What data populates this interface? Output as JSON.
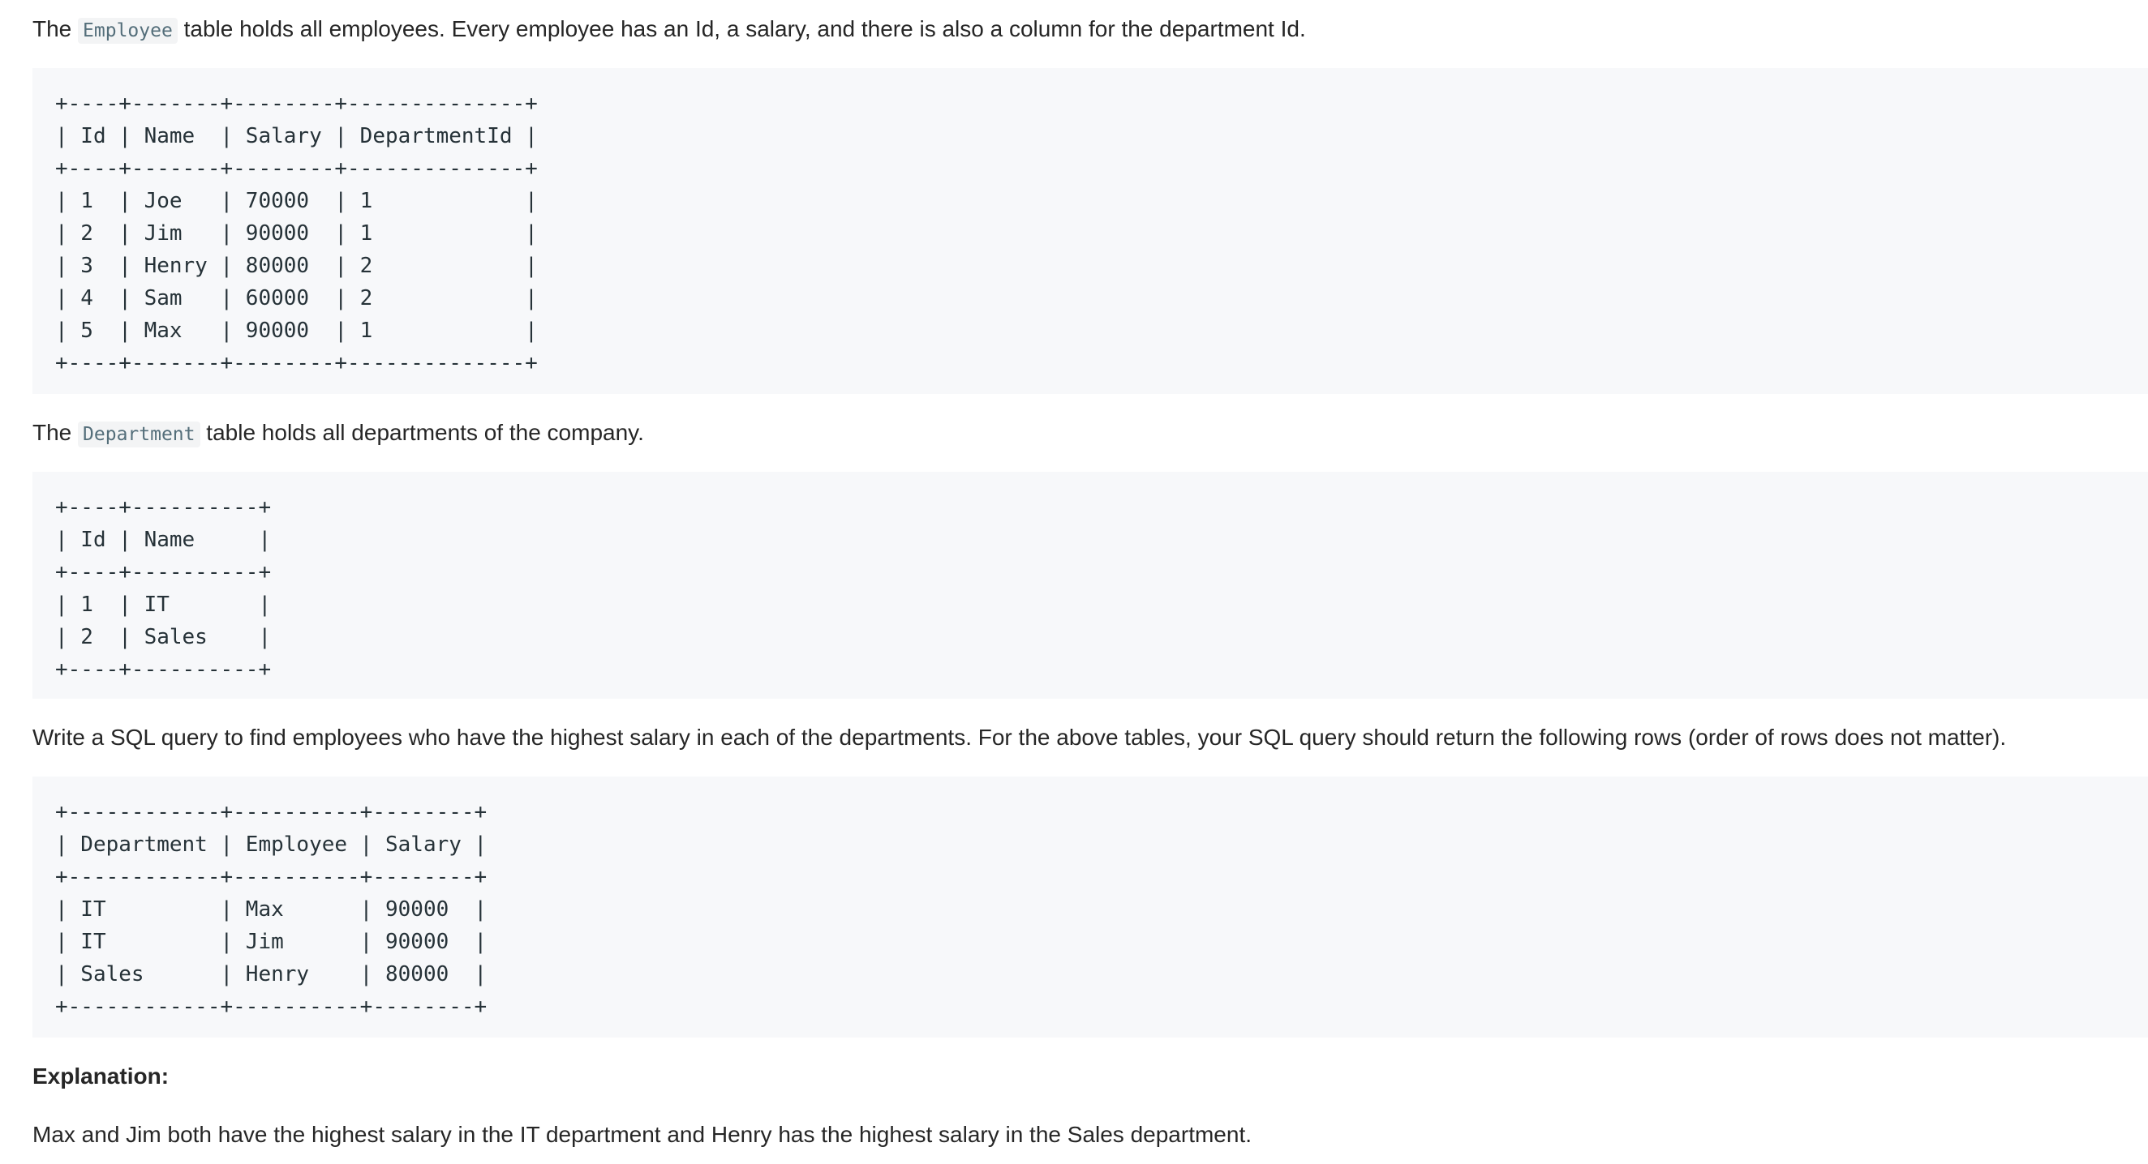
{
  "intro": {
    "pre": "The",
    "code": "Employee",
    "post": "table holds all employees. Every employee has an Id, a salary, and there is also a column for the department Id."
  },
  "employee_table": "+----+-------+--------+--------------+\n| Id | Name  | Salary | DepartmentId |\n+----+-------+--------+--------------+\n| 1  | Joe   | 70000  | 1            |\n| 2  | Jim   | 90000  | 1            |\n| 3  | Henry | 80000  | 2            |\n| 4  | Sam   | 60000  | 2            |\n| 5  | Max   | 90000  | 1            |\n+----+-------+--------+--------------+",
  "department_intro": {
    "pre": "The",
    "code": "Department",
    "post": "table holds all departments of the company."
  },
  "department_table": "+----+----------+\n| Id | Name     |\n+----+----------+\n| 1  | IT       |\n| 2  | Sales    |\n+----+----------+",
  "task": "Write a SQL query to find employees who have the highest salary in each of the departments. For the above tables, your SQL query should return the following rows (order of rows does not matter).",
  "result_table": "+------------+----------+--------+\n| Department | Employee | Salary |\n+------------+----------+--------+\n| IT         | Max      | 90000  |\n| IT         | Jim      | 90000  |\n| Sales      | Henry    | 80000  |\n+------------+----------+--------+",
  "explanation_heading": "Explanation:",
  "explanation_text": "Max and Jim both have the highest salary in the IT department and Henry has the highest salary in the Sales department."
}
